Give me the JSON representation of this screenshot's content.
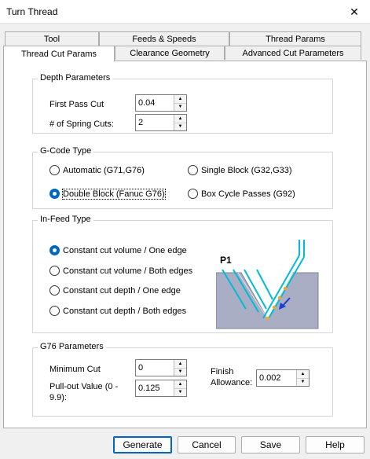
{
  "window": {
    "title": "Turn Thread",
    "close_glyph": "✕"
  },
  "tabs_back": [
    "Tool",
    "Feeds & Speeds",
    "Thread Params"
  ],
  "tabs_front": [
    "Thread Cut Params",
    "Clearance Geometry",
    "Advanced Cut Parameters"
  ],
  "depth": {
    "legend": "Depth Parameters",
    "first_pass_label": "First Pass Cut",
    "first_pass_value": "0.04",
    "spring_cuts_label": "# of Spring Cuts:",
    "spring_cuts_value": "2"
  },
  "gcode": {
    "legend": "G-Code Type",
    "options": [
      "Automatic (G71,G76)",
      "Single Block  (G32,G33)",
      "Double Block (Fanuc G76)",
      "Box Cycle Passes (G92)"
    ],
    "selected": "Double Block (Fanuc G76)"
  },
  "infeed": {
    "legend": "In-Feed Type",
    "options": [
      "Constant cut volume / One edge",
      "Constant cut volume / Both edges",
      "Constant cut depth / One edge",
      "Constant cut depth / Both edges"
    ],
    "selected": "Constant cut volume / One edge",
    "diagram_label": "P1"
  },
  "g76": {
    "legend": "G76 Parameters",
    "min_cut_label": "Minimum Cut",
    "min_cut_value": "0",
    "pullout_label_1": "Pull-out Value (0 -",
    "pullout_label_2": "9.9):",
    "pullout_value": "0.125",
    "finish_label_1": "Finish",
    "finish_label_2": "Allowance:",
    "finish_value": "0.002"
  },
  "buttons": {
    "generate": "Generate",
    "cancel": "Cancel",
    "save": "Save",
    "help": "Help"
  },
  "icons": {
    "spin_up": "▲",
    "spin_down": "▼"
  },
  "colors": {
    "accent": "#0067c0",
    "toolpath": "#00bcd4",
    "stock": "#a9aec4",
    "arrow": "#1a3fd1",
    "points": "#f5a623"
  }
}
